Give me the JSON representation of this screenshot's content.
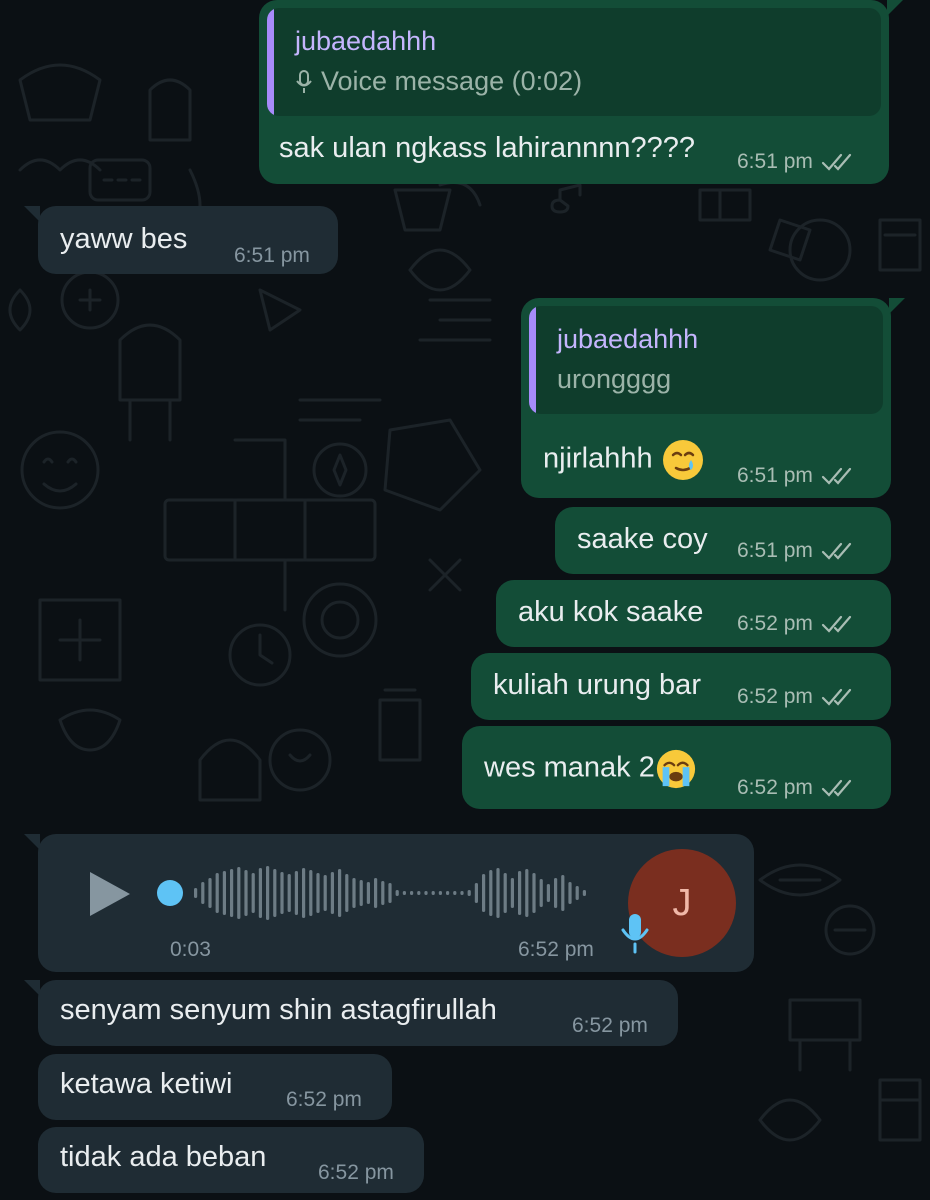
{
  "messages": [
    {
      "id": "m1",
      "direction": "outgoing",
      "reply": {
        "author": "jubaedahhh",
        "preview_icon": "mic-icon",
        "preview": "Voice message (0:02)"
      },
      "text": "sak ulan ngkass lahirannnn????",
      "time": "6:51 pm",
      "status": "read"
    },
    {
      "id": "m2",
      "direction": "incoming",
      "text": "yaww bes",
      "time": "6:51 pm"
    },
    {
      "id": "m3",
      "direction": "outgoing",
      "reply": {
        "author": "jubaedahhh",
        "preview": "urongggg"
      },
      "text": "njirlahhh",
      "emoji": "crying-face-with-tear-emoji",
      "time": "6:51 pm",
      "status": "read"
    },
    {
      "id": "m4",
      "direction": "outgoing",
      "text": "saake coy",
      "time": "6:51 pm",
      "status": "read"
    },
    {
      "id": "m5",
      "direction": "outgoing",
      "text": "aku kok saake",
      "time": "6:52 pm",
      "status": "read"
    },
    {
      "id": "m6",
      "direction": "outgoing",
      "text": "kuliah urung bar",
      "time": "6:52 pm",
      "status": "read"
    },
    {
      "id": "m7",
      "direction": "outgoing",
      "text": "wes manak 2",
      "emoji": "loudly-crying-face-emoji",
      "time": "6:52 pm",
      "status": "read"
    },
    {
      "id": "m8",
      "direction": "incoming",
      "type": "voice",
      "duration": "0:03",
      "time": "6:52 pm",
      "progress": 0.0,
      "avatar_initial": "J",
      "avatar_color": "#7a2e1f",
      "play_icon": "play-icon",
      "mic_icon": "mic-icon"
    },
    {
      "id": "m9",
      "direction": "incoming",
      "text": "senyam senyum shin astagfirullah",
      "time": "6:52 pm"
    },
    {
      "id": "m10",
      "direction": "incoming",
      "text": "ketawa ketiwi",
      "time": "6:52 pm"
    },
    {
      "id": "m11",
      "direction": "incoming",
      "text": "tidak ada beban",
      "time": "6:52 pm"
    }
  ],
  "colors": {
    "outgoing_bubble": "#134d37",
    "incoming_bubble": "#1f2c34",
    "background": "#0b1014",
    "reply_bar": "#a78bfa",
    "read_ticks": "#a9bdb4",
    "voice_dot": "#5ec3f5"
  }
}
